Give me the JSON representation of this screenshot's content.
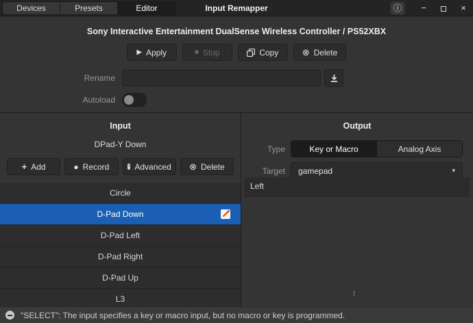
{
  "window": {
    "title": "Input Remapper",
    "tabs": [
      {
        "label": "Devices",
        "active": false
      },
      {
        "label": "Presets",
        "active": false
      },
      {
        "label": "Editor",
        "active": true
      }
    ],
    "controls": {
      "info": "ⓘ",
      "minimize": "−",
      "close": "×"
    }
  },
  "device_header": "Sony Interactive Entertainment DualSense Wireless Controller  /  PS52XBX",
  "preset_actions": {
    "apply": {
      "label": "Apply",
      "icon": "▶",
      "enabled": true
    },
    "stop": {
      "label": "Stop",
      "icon": "■",
      "enabled": false
    },
    "copy": {
      "label": "Copy",
      "enabled": true
    },
    "delete": {
      "label": "Delete",
      "icon": "⊗",
      "enabled": true
    }
  },
  "rename": {
    "label": "Rename",
    "value": "",
    "placeholder": ""
  },
  "autoload": {
    "label": "Autoload",
    "enabled": false
  },
  "input_panel": {
    "title": "Input",
    "current_input": "DPad-Y Down",
    "buttons": {
      "add": {
        "label": "Add",
        "icon": "+"
      },
      "record": {
        "label": "Record",
        "icon": "●"
      },
      "advanced": {
        "label": "Advanced"
      },
      "delete": {
        "label": "Delete",
        "icon": "⊗"
      }
    },
    "list": [
      {
        "label": "Circle",
        "selected": false
      },
      {
        "label": "D-Pad Down",
        "selected": true
      },
      {
        "label": "D-Pad Left",
        "selected": false
      },
      {
        "label": "D-Pad Right",
        "selected": false
      },
      {
        "label": "D-Pad Up",
        "selected": false
      },
      {
        "label": "L3",
        "selected": false
      }
    ]
  },
  "output_panel": {
    "title": "Output",
    "type_label": "Type",
    "type_options": [
      {
        "label": "Key or Macro",
        "active": true
      },
      {
        "label": "Analog Axis",
        "active": false
      }
    ],
    "target_label": "Target",
    "target_value": "gamepad",
    "caret": "▾",
    "code_value": "Left",
    "stray_text": "t"
  },
  "status_bar": {
    "message": "\"SELECT\": The input specifies a key or macro input, but no macro or key is programmed."
  },
  "colors": {
    "selection_blue": "#1a5fb4",
    "titlebar": "#242424",
    "background": "#343434",
    "status_bar": "#3a3a3a"
  }
}
